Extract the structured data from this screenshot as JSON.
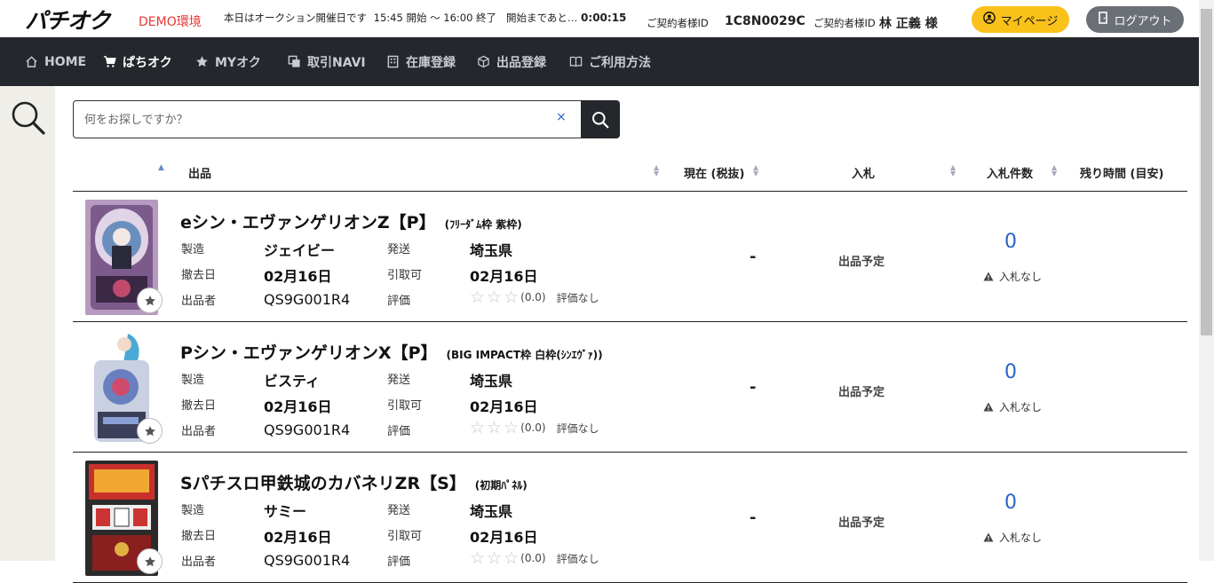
{
  "header": {
    "logo": "パチオク",
    "demo": "DEMO環境",
    "auction_info": "本日はオークション開催日です",
    "time_range": "15:45 開始 ～ 16:00 終了",
    "countdown_label": "開始まであと…",
    "countdown": "0:00:15",
    "contract_id_label": "ご契約者様ID",
    "contract_id": "1C8N0029C",
    "contract_name_label": "ご契約者様ID",
    "contract_name": "林 正義 様",
    "mypage_label": "マイページ",
    "logout_label": "ログアウト"
  },
  "nav": {
    "items": [
      {
        "label": "HOME",
        "icon": "home-icon"
      },
      {
        "label": "ぱちオク",
        "icon": "cart-icon"
      },
      {
        "label": "MYオク",
        "icon": "star-icon"
      },
      {
        "label": "取引NAVI",
        "icon": "copy-icon"
      },
      {
        "label": "在庫登録",
        "icon": "building-icon"
      },
      {
        "label": "出品登録",
        "icon": "box-icon"
      },
      {
        "label": "ご利用方法",
        "icon": "book-icon"
      }
    ]
  },
  "search": {
    "placeholder": "何をお探しですか？",
    "clear": "×"
  },
  "table": {
    "headers": {
      "product": "出品",
      "current": "現在 (税抜)",
      "bid": "入札",
      "bid_count": "入札件数",
      "remaining": "残り時間 (目安)"
    },
    "labels": {
      "maker": "製造",
      "removal_date": "撤去日",
      "seller": "出品者",
      "shipping": "発送",
      "pickup": "引取可",
      "rating": "評価"
    },
    "rows": [
      {
        "title": "eシン・エヴァンゲリオンZ【P】",
        "subtitle": "(ﾌﾘｰﾀﾞﾑ枠 紫枠)",
        "maker": "ジェイビー",
        "removal_date": "02月16日",
        "seller": "QS9G001R4",
        "shipping": "埼玉県",
        "pickup": "02月16日",
        "rating_score": "(0.0)",
        "rating_text": "評価なし",
        "current": "-",
        "status": "出品予定",
        "bid_count": "0",
        "bid_note": "入札なし"
      },
      {
        "title": "Pシン・エヴァンゲリオンX【P】",
        "subtitle": "(BIG IMPACT枠 白枠(ｼﾝｴｳﾞｧ))",
        "maker": "ビスティ",
        "removal_date": "02月16日",
        "seller": "QS9G001R4",
        "shipping": "埼玉県",
        "pickup": "02月16日",
        "rating_score": "(0.0)",
        "rating_text": "評価なし",
        "current": "-",
        "status": "出品予定",
        "bid_count": "0",
        "bid_note": "入札なし"
      },
      {
        "title": "Sパチスロ甲鉄城のカバネリZR【S】",
        "subtitle": "(初期ﾊﾟﾈﾙ)",
        "maker": "サミー",
        "removal_date": "02月16日",
        "seller": "QS9G001R4",
        "shipping": "埼玉県",
        "pickup": "02月16日",
        "rating_score": "(0.0)",
        "rating_text": "評価なし",
        "current": "-",
        "status": "出品予定",
        "bid_count": "0",
        "bid_note": "入札なし"
      }
    ]
  },
  "colors": {
    "nav_bg": "#24272c",
    "mypage": "#f9c11a",
    "logout": "#6b7076",
    "bid_count": "#2a62c9",
    "demo": "#e53935"
  }
}
